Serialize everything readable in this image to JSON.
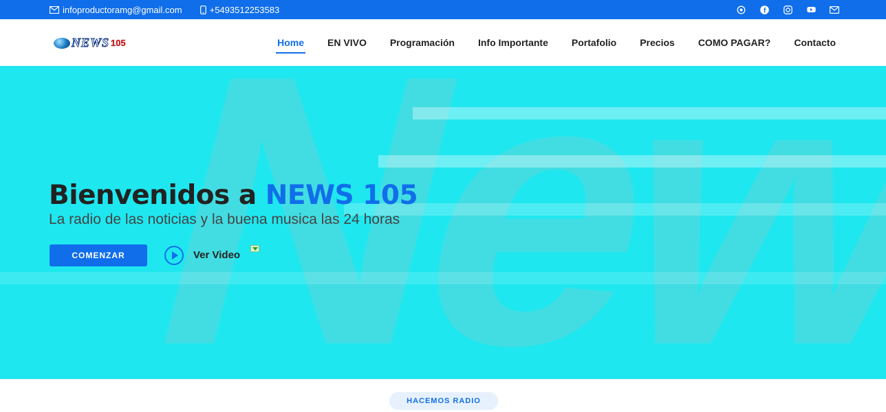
{
  "topbar": {
    "email": "infoproductoramg@gmail.com",
    "phone": "+5493512253583",
    "socials": [
      "whatsapp-icon",
      "facebook-icon",
      "instagram-icon",
      "youtube-icon",
      "mail-icon"
    ]
  },
  "header": {
    "logo_text": "NEWS",
    "logo_number": "105",
    "nav": [
      {
        "label": "Home",
        "active": true
      },
      {
        "label": "EN VIVO"
      },
      {
        "label": "Programación"
      },
      {
        "label": "Info Importante"
      },
      {
        "label": "Portafolio"
      },
      {
        "label": "Precios"
      },
      {
        "label": "COMO PAGAR?"
      },
      {
        "label": "Contacto"
      }
    ]
  },
  "hero": {
    "title_prefix": "Bienvenidos a ",
    "title_brand": "NEWS 105",
    "subtitle": "La radio de las noticias y la buena musica las 24 horas",
    "cta_label": "COMENZAR",
    "video_label": "Ver Video",
    "background_text": "News",
    "accent_color": "#106eea",
    "background_color": "#1fe7ef"
  },
  "section": {
    "tag": "HACEMOS RADIO"
  }
}
